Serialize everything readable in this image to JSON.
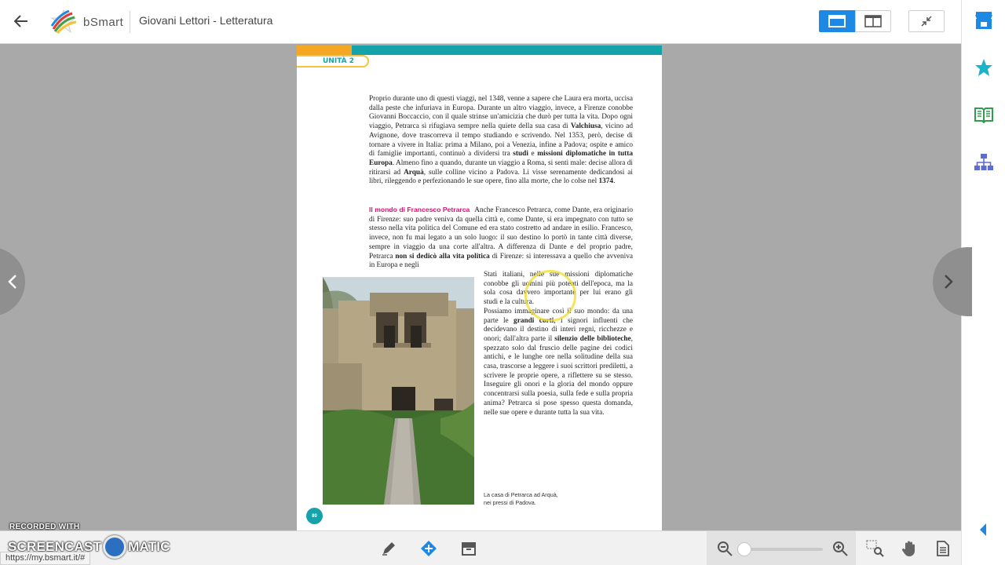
{
  "header": {
    "back_icon": "arrow-left-icon",
    "logo_text": "bSmart",
    "book_title": "Giovani Lettori - Letteratura",
    "view_single_icon": "single-page-icon",
    "view_double_icon": "double-page-icon",
    "fullscreen_icon": "collapse-icon"
  },
  "sidebar": {
    "items": [
      {
        "icon": "store-icon",
        "color": "#1e88e5"
      },
      {
        "icon": "star-icon",
        "color": "#1ab3c9"
      },
      {
        "icon": "book-icon",
        "color": "#2e9e4e"
      },
      {
        "icon": "hierarchy-icon",
        "color": "#5e6bd1"
      }
    ],
    "collapse_icon": "chevron-left-icon"
  },
  "page": {
    "unit_label": "UNITÀ 2",
    "p1": [
      {
        "t": "Proprio durante uno di questi viaggi, nel 1348, venne a sapere che Laura era morta, uccisa dalla peste che infuriava in Europa. Durante un altro viaggio, invece, a Firenze conobbe Giovanni Boccaccio, con il quale strinse un'amicizia che durò per tutta la vita. Dopo ogni viaggio, Petrarca si rifugiava sempre nella quiete della sua casa di "
      },
      {
        "t": "Valchiusa",
        "b": true
      },
      {
        "t": ", vicino ad Avignone, dove trascorreva il tempo studiando e scrivendo. Nel 1353, però, decise di tornare a vivere in Italia: prima a Milano, poi a Venezia, infine a Padova; ospite e amico di famiglie importanti, continuò a dividersi tra "
      },
      {
        "t": "studi",
        "b": true
      },
      {
        "t": " e "
      },
      {
        "t": "missioni diplomatiche in tutta Europa",
        "b": true
      },
      {
        "t": ". Almeno fino a quando, durante un viaggio a Roma, si sentì male: decise allora di ritirarsi ad "
      },
      {
        "t": "Arquà",
        "b": true
      },
      {
        "t": ", sulle colline vicino a Padova. Lì visse serenamente dedicandosi ai libri, rileggendo e perfezionando le sue opere, fino alla morte, che lo colse nel "
      },
      {
        "t": "1374",
        "b": true
      },
      {
        "t": "."
      }
    ],
    "section_heading": "Il mondo di Francesco Petrarca",
    "p2": [
      {
        "t": "Anche Francesco Petrarca, come Dante, era originario di Firenze: suo padre veniva da quella città e, come Dante, si era impegnato con tutto se stesso nella vita politica del Comune ed era stato costretto ad andare in esilio. Francesco, invece, non fu mai legato a un solo luogo: il suo destino lo portò in tante città diverse, sempre in viaggio da una corte all'altra. A differenza di Dante e del proprio padre, Petrarca "
      },
      {
        "t": "non si dedicò alla vita politica",
        "b": true
      },
      {
        "t": " di Firenze: si interessava a quello che avveniva in Europa e negli"
      }
    ],
    "p3": [
      {
        "t": "Stati italiani, nelle sue missioni diplomatiche conobbe gli uomini più potenti dell'epoca, ma la sola cosa davvero importante per lui erano gli studi e la cultura."
      },
      {
        "br": true
      },
      {
        "t": "Possiamo immaginare così il suo mondo: da una parte le "
      },
      {
        "t": "grandi corti",
        "b": true
      },
      {
        "t": ", i signori influenti che decidevano il destino di interi regni, ricchezze e onori; dall'altra parte il "
      },
      {
        "t": "silenzio delle biblioteche",
        "b": true
      },
      {
        "t": ", spezzato solo dal fruscio delle pagine dei codici antichi, e le lunghe ore nella solitudine della sua casa, trascorse a leggere i suoi scrittori prediletti, a scrivere le proprie opere, a riflettere su se stesso. Inseguire gli onori e la gloria del mondo oppure concentrarsi sulla poesia, sulla fede e sulla propria anima? Petrarca si pose spesso questa domanda, nelle sue opere e durante tutta la sua vita."
      }
    ],
    "caption": [
      "La casa di Petrarca ad Arquà,",
      "nei pressi di Padova."
    ],
    "page_number": "80"
  },
  "bottombar": {
    "tools": [
      "pencil-icon",
      "add-resource-icon",
      "archive-icon"
    ],
    "zoom_out_icon": "zoom-out-icon",
    "zoom_in_icon": "zoom-in-icon",
    "zoom_level": 0.0,
    "right_tools": [
      "select-zoom-icon",
      "hand-icon",
      "document-icon"
    ]
  },
  "watermark": {
    "line1": "RECORDED WITH",
    "line2a": "SCREENCAST",
    "line2b": "MATIC"
  },
  "status_url": "https://my.bsmart.it/#",
  "colors": {
    "accent": "#1e88e5",
    "teal": "#14a3a9",
    "orange": "#f5a623",
    "heading_magenta": "#e0116e"
  }
}
